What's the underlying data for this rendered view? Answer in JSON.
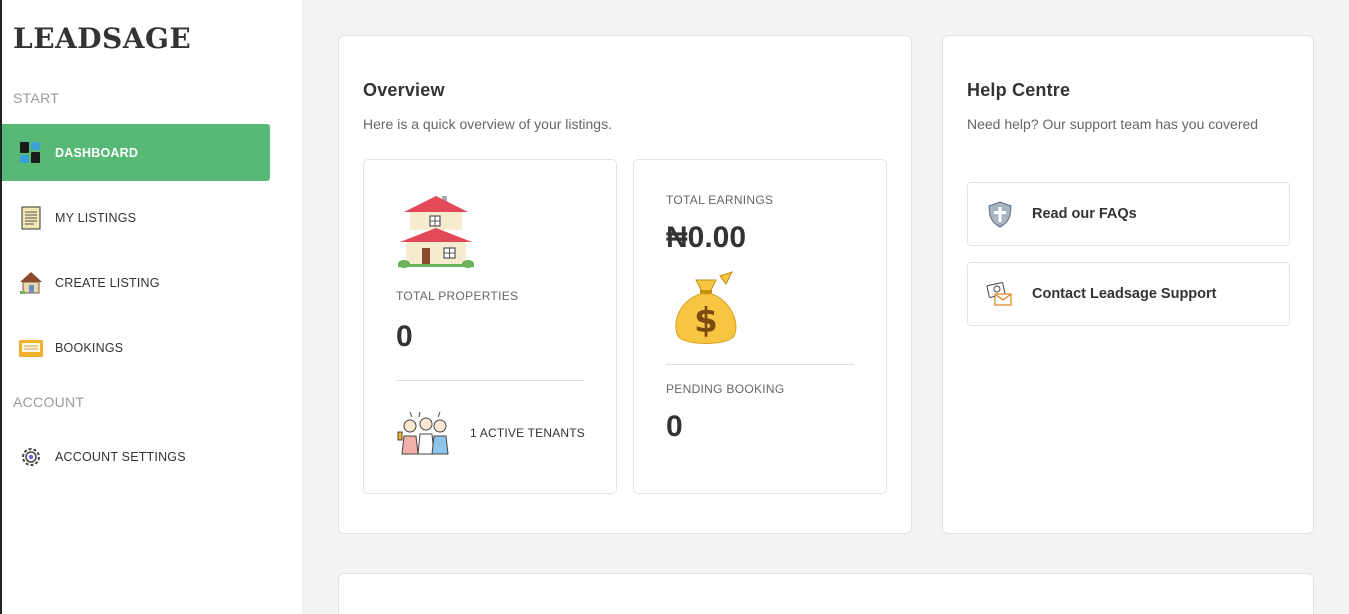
{
  "brand": "LEADSAGE",
  "sidebar": {
    "sections": [
      "START",
      "ACCOUNT"
    ],
    "items": [
      {
        "label": "DASHBOARD",
        "icon": "dashboard-icon",
        "active": true
      },
      {
        "label": "MY LISTINGS",
        "icon": "document-icon"
      },
      {
        "label": "CREATE LISTING",
        "icon": "house-icon"
      },
      {
        "label": "BOOKINGS",
        "icon": "folder-icon"
      },
      {
        "label": "ACCOUNT SETTINGS",
        "icon": "gear-icon"
      }
    ]
  },
  "overview": {
    "title": "Overview",
    "subtitle": "Here is a quick overview of your listings.",
    "properties": {
      "label": "TOTAL PROPERTIES",
      "value": "0"
    },
    "tenants": {
      "label": "1 ACTIVE TENANTS"
    },
    "earnings": {
      "label": "TOTAL EARNINGS",
      "value": "₦0.00"
    },
    "pending": {
      "label": "PENDING BOOKING",
      "value": "0"
    }
  },
  "help": {
    "title": "Help Centre",
    "subtitle": "Need help? Our support team has you covered",
    "links": [
      {
        "label": "Read our FAQs",
        "icon": "shield-icon"
      },
      {
        "label": "Contact Leadsage Support",
        "icon": "mail-icon"
      }
    ]
  },
  "colors": {
    "accent": "#58b875",
    "background": "#f3f3f3"
  }
}
